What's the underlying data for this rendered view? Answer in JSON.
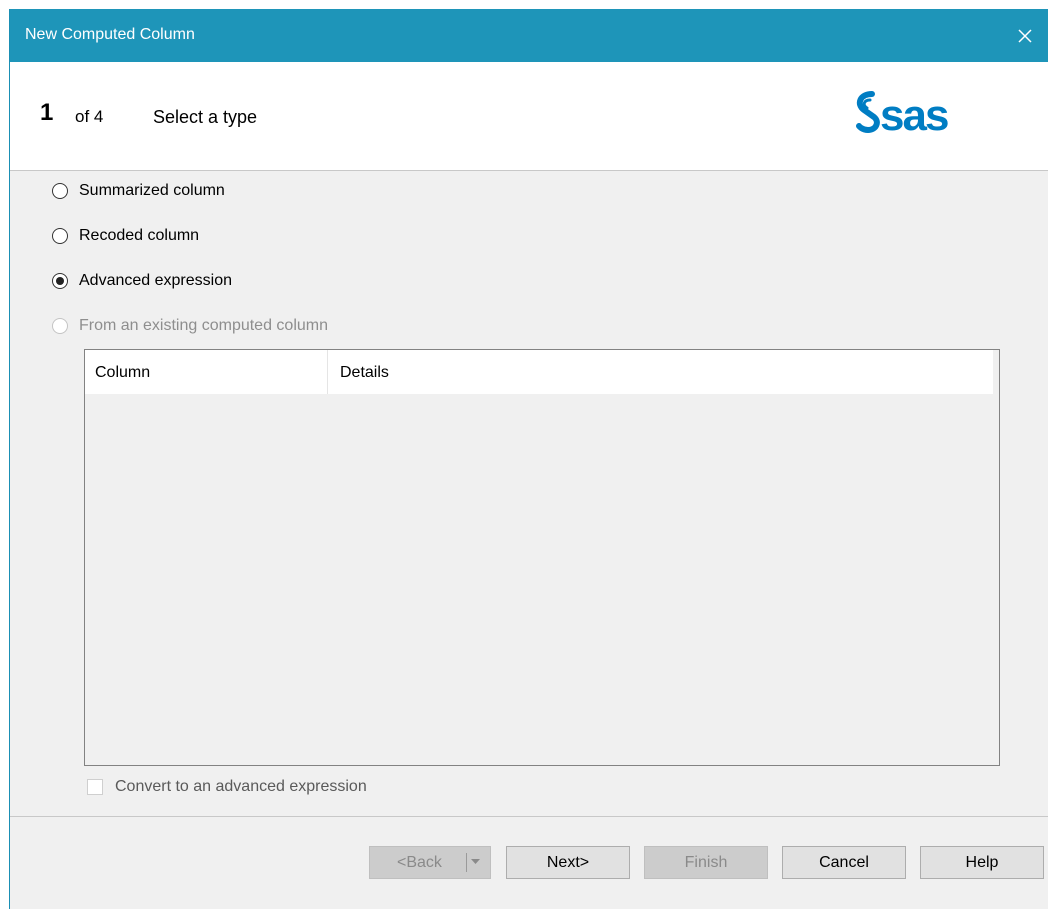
{
  "window": {
    "title": "New Computed Column",
    "close_icon": "close-icon"
  },
  "header": {
    "step_number": "1",
    "step_of": "of 4",
    "step_title": "Select a type",
    "logo_text": "sas",
    "logo_icon": "sas-logo"
  },
  "options": [
    {
      "label": "Summarized column",
      "selected": false,
      "enabled": true
    },
    {
      "label": "Recoded column",
      "selected": false,
      "enabled": true
    },
    {
      "label": "Advanced expression",
      "selected": true,
      "enabled": true
    },
    {
      "label": "From an existing computed column",
      "selected": false,
      "enabled": false
    }
  ],
  "table": {
    "columns": [
      "Column",
      "Details"
    ],
    "rows": []
  },
  "convert": {
    "label": "Convert to an advanced expression",
    "checked": false,
    "enabled": false
  },
  "buttons": {
    "back": "<Back",
    "next": "Next>",
    "finish": "Finish",
    "cancel": "Cancel",
    "help": "Help"
  },
  "colors": {
    "titlebar": "#1e95b9",
    "brand": "#007dc3"
  }
}
